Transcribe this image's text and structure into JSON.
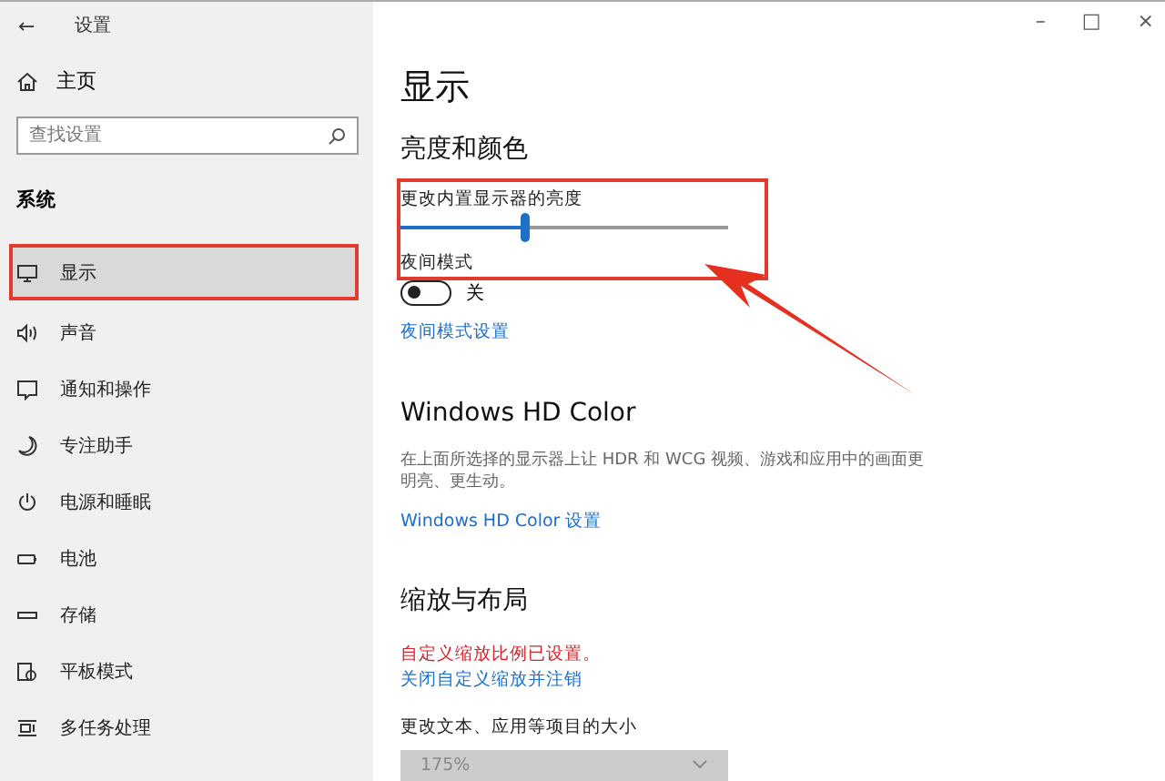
{
  "window": {
    "title": "设置",
    "back": "←",
    "controls": [
      "–",
      "□",
      "×"
    ]
  },
  "sidebar": {
    "home": "主页",
    "search": {
      "placeholder": "查找设置"
    },
    "section": "系统",
    "items": [
      {
        "label": "显示",
        "selected": true
      },
      {
        "label": "声音",
        "selected": false
      },
      {
        "label": "通知和操作",
        "selected": false
      },
      {
        "label": "专注助手",
        "selected": false
      },
      {
        "label": "电源和睡眠",
        "selected": false
      },
      {
        "label": "电池",
        "selected": false
      },
      {
        "label": "存储",
        "selected": false
      },
      {
        "label": "平板模式",
        "selected": false
      },
      {
        "label": "多任务处理",
        "selected": false
      }
    ]
  },
  "main": {
    "title": "显示",
    "brightness": {
      "heading": "亮度和颜色",
      "slider_label": "更改内置显示器的亮度",
      "level": 0.38,
      "night_label": "夜间模式",
      "night_on": false,
      "night_state": "关",
      "night_link": "夜间模式设置"
    },
    "hd": {
      "heading": "Windows HD Color",
      "text": "在上面所选择的显示器上让 HDR 和 WCG 视频、游戏和应用中的画面更明亮、更生动。",
      "link": "Windows HD Color 设置"
    },
    "scale": {
      "heading": "缩放与布局",
      "warning": "自定义缩放比例已设置。",
      "link": "关闭自定义缩放并注销",
      "size_label": "更改文本、应用等项目的大小",
      "size_value": "175%",
      "disabled": true
    }
  }
}
